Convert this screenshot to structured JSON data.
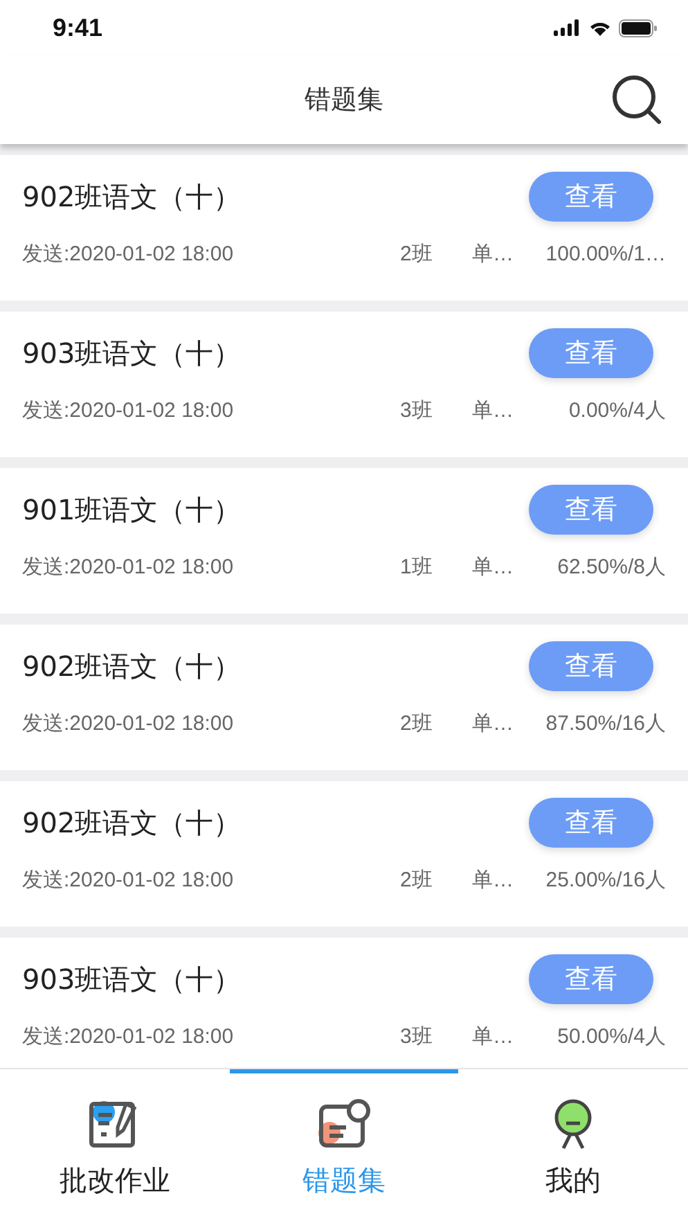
{
  "status_bar": {
    "time": "9:41"
  },
  "header": {
    "title": "错题集"
  },
  "items": [
    {
      "title": "902班语文（十）",
      "button": "查看",
      "sent": "发送:2020-01-02 18:00",
      "class": "2班",
      "type": "单…",
      "rate": "100.00%/1…"
    },
    {
      "title": "903班语文（十）",
      "button": "查看",
      "sent": "发送:2020-01-02 18:00",
      "class": "3班",
      "type": "单…",
      "rate": "0.00%/4人"
    },
    {
      "title": "901班语文（十）",
      "button": "查看",
      "sent": "发送:2020-01-02 18:00",
      "class": "1班",
      "type": "单…",
      "rate": "62.50%/8人"
    },
    {
      "title": "902班语文（十）",
      "button": "查看",
      "sent": "发送:2020-01-02 18:00",
      "class": "2班",
      "type": "单…",
      "rate": "87.50%/16人"
    },
    {
      "title": "902班语文（十）",
      "button": "查看",
      "sent": "发送:2020-01-02 18:00",
      "class": "2班",
      "type": "单…",
      "rate": "25.00%/16人"
    },
    {
      "title": "903班语文（十）",
      "button": "查看",
      "sent": "发送:2020-01-02 18:00",
      "class": "3班",
      "type": "单…",
      "rate": "50.00%/4人"
    }
  ],
  "tab_bar": [
    {
      "kind": "grading",
      "label": "批改作业",
      "selected": false
    },
    {
      "kind": "mistakes",
      "label": "错题集",
      "selected": true
    },
    {
      "kind": "profile",
      "label": "我的",
      "selected": false
    }
  ]
}
